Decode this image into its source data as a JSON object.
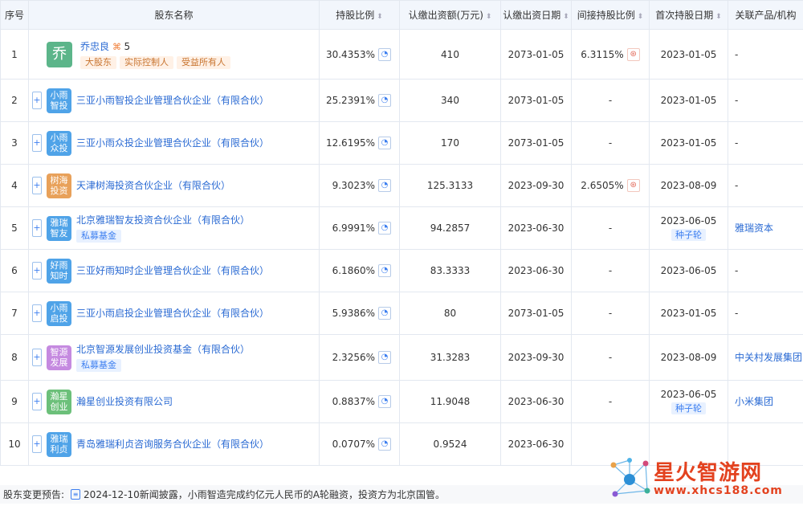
{
  "headers": {
    "seq": "序号",
    "name": "股东名称",
    "ratio": "持股比例",
    "capital": "认缴出资额(万元)",
    "date": "认缴出资日期",
    "indirect": "间接持股比例",
    "first": "首次持股日期",
    "related": "关联产品/机构"
  },
  "rows": [
    {
      "seq": "1",
      "logo": "乔",
      "logo_color": "#5cb58a",
      "name": "乔忠良",
      "count": "5",
      "tags": [
        "大股东",
        "实际控制人",
        "受益所有人"
      ],
      "ratio": "30.4353%",
      "capital": "410",
      "date": "2073-01-05",
      "indirect": "6.3115%",
      "first": "2023-01-05",
      "round": "",
      "related": "-"
    },
    {
      "seq": "2",
      "logo": "小雨智投",
      "logo_color": "#4fa3e8",
      "name": "三亚小雨智投企业管理合伙企业（有限合伙）",
      "ratio": "25.2391%",
      "capital": "340",
      "date": "2073-01-05",
      "indirect": "-",
      "first": "2023-01-05",
      "round": "",
      "related": "-"
    },
    {
      "seq": "3",
      "logo": "小雨众投",
      "logo_color": "#4fa3e8",
      "name": "三亚小雨众投企业管理合伙企业（有限合伙）",
      "ratio": "12.6195%",
      "capital": "170",
      "date": "2073-01-05",
      "indirect": "-",
      "first": "2023-01-05",
      "round": "",
      "related": "-"
    },
    {
      "seq": "4",
      "logo": "树海投资",
      "logo_color": "#e8a15a",
      "name": "天津树海投资合伙企业（有限合伙）",
      "ratio": "9.3023%",
      "capital": "125.3133",
      "date": "2023-09-30",
      "indirect": "2.6505%",
      "first": "2023-08-09",
      "round": "",
      "related": "-"
    },
    {
      "seq": "5",
      "logo": "雅瑞智友",
      "logo_color": "#4fa3e8",
      "name": "北京雅瑞智友投资合伙企业（有限合伙）",
      "tags": [
        "私募基金"
      ],
      "ratio": "6.9991%",
      "capital": "94.2857",
      "date": "2023-06-30",
      "indirect": "-",
      "first": "2023-06-05",
      "round": "种子轮",
      "related": "雅瑞资本"
    },
    {
      "seq": "6",
      "logo": "好雨知时",
      "logo_color": "#4fa3e8",
      "name": "三亚好雨知时企业管理合伙企业（有限合伙）",
      "ratio": "6.1860%",
      "capital": "83.3333",
      "date": "2023-06-30",
      "indirect": "-",
      "first": "2023-06-05",
      "round": "",
      "related": "-"
    },
    {
      "seq": "7",
      "logo": "小雨启投",
      "logo_color": "#4fa3e8",
      "name": "三亚小雨启投企业管理合伙企业（有限合伙）",
      "ratio": "5.9386%",
      "capital": "80",
      "date": "2073-01-05",
      "indirect": "-",
      "first": "2023-01-05",
      "round": "",
      "related": "-"
    },
    {
      "seq": "8",
      "logo": "智源发展",
      "logo_color": "#c58ae0",
      "name": "北京智源发展创业投资基金（有限合伙）",
      "tags": [
        "私募基金"
      ],
      "ratio": "2.3256%",
      "capital": "31.3283",
      "date": "2023-09-30",
      "indirect": "-",
      "first": "2023-08-09",
      "round": "",
      "related": "中关村发展集团"
    },
    {
      "seq": "9",
      "logo": "瀚星创业",
      "logo_color": "#6cc07a",
      "name": "瀚星创业投资有限公司",
      "ratio": "0.8837%",
      "capital": "11.9048",
      "date": "2023-06-30",
      "indirect": "-",
      "first": "2023-06-05",
      "round": "种子轮",
      "related": "小米集团"
    },
    {
      "seq": "10",
      "logo": "雅瑞利贞",
      "logo_color": "#4fa3e8",
      "name": "青岛雅瑞利贞咨询服务合伙企业（有限合伙）",
      "ratio": "0.0707%",
      "capital": "0.9524",
      "date": "2023-06-30",
      "indirect": "",
      "first": "",
      "round": "",
      "related": ""
    }
  ],
  "footer": {
    "label": "股东变更预告:",
    "text": "2024-12-10新闻披露，小雨智造完成约亿元人民币的A轮融资，投资方为北京国管。"
  },
  "watermark": {
    "title": "星火智游网",
    "url": "www.xhcs188.com"
  }
}
